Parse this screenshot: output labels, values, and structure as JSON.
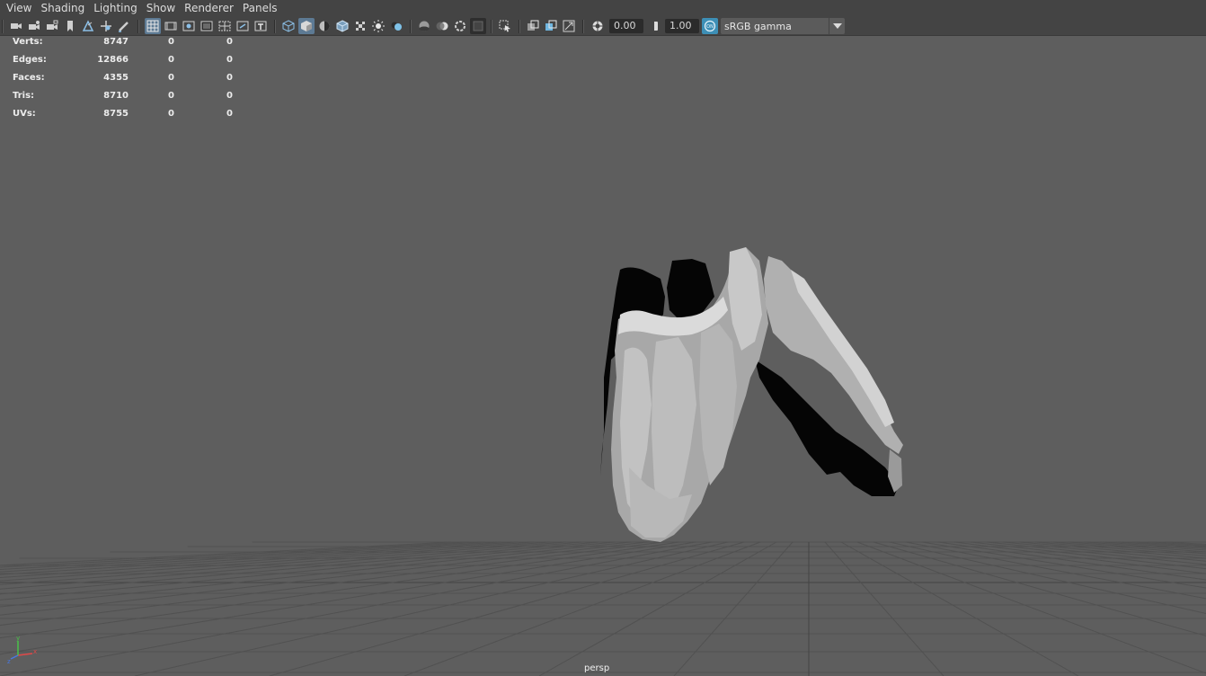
{
  "menu": [
    "View",
    "Shading",
    "Lighting",
    "Show",
    "Renderer",
    "Panels"
  ],
  "toolbar": {
    "exposure_value": "0.00",
    "gamma_value": "1.00",
    "color_space": "sRGB gamma",
    "icons": [
      "camera-icon",
      "camera-attributes-icon",
      "camera-lock-icon",
      "bookmark-icon",
      "image-plane-icon",
      "2d-pan-zoom-icon",
      "grease-pencil-icon",
      "grid-icon",
      "film-gate-icon",
      "resolution-gate-icon",
      "gate-mask-icon",
      "field-chart-icon",
      "safe-action-icon",
      "safe-title-icon",
      "wireframe-icon",
      "smooth-shade-icon",
      "default-material-icon",
      "wireframe-on-shaded-icon",
      "xray-icon",
      "use-all-lights-icon",
      "shadows-icon",
      "screen-space-ao-icon",
      "motion-blur-icon",
      "anti-aliasing-icon",
      "depth-of-field-icon",
      "isolate-select-icon",
      "xray-joints-icon",
      "xray-active-icon",
      "backface-icon",
      "exposure-icon",
      "gamma-icon",
      "color-management-icon",
      "dropdown-arrow-icon"
    ]
  },
  "hud": [
    {
      "label": "Verts:",
      "v1": "8747",
      "v2": "0",
      "v3": "0"
    },
    {
      "label": "Edges:",
      "v1": "12866",
      "v2": "0",
      "v3": "0"
    },
    {
      "label": "Faces:",
      "v1": "4355",
      "v2": "0",
      "v3": "0"
    },
    {
      "label": "Tris:",
      "v1": "8710",
      "v2": "0",
      "v3": "0"
    },
    {
      "label": "UVs:",
      "v1": "8755",
      "v2": "0",
      "v3": "0"
    }
  ],
  "viewport": {
    "camera": "persp",
    "background_color": "#5e5e5e",
    "grid_color": "#4f4f4f",
    "axis_labels": {
      "x": "x",
      "y": "y",
      "z": "z"
    }
  }
}
